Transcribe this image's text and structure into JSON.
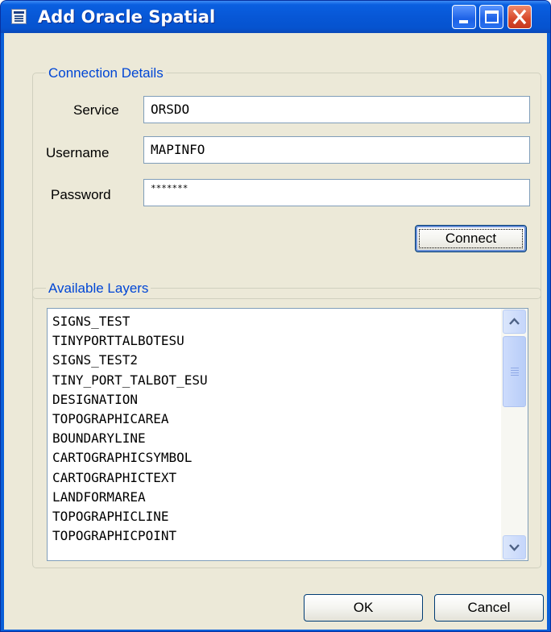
{
  "window": {
    "title": "Add Oracle Spatial"
  },
  "connection": {
    "group_label": "Connection Details",
    "service_label": "Service",
    "service_value": "ORSDO",
    "username_label": "Username",
    "username_value": "MAPINFO",
    "password_label": "Password",
    "password_value": "*******",
    "connect_label": "Connect"
  },
  "layers": {
    "group_label": "Available Layers",
    "items": [
      "SIGNS_TEST",
      "TINYPORTTALBOTESU",
      "SIGNS_TEST2",
      "TINY_PORT_TALBOT_ESU",
      "DESIGNATION",
      "TOPOGRAPHICAREA",
      "BOUNDARYLINE",
      "CARTOGRAPHICSYMBOL",
      "CARTOGRAPHICTEXT",
      "LANDFORMAREA",
      "TOPOGRAPHICLINE",
      "TOPOGRAPHICPOINT"
    ]
  },
  "footer": {
    "ok_label": "OK",
    "cancel_label": "Cancel"
  },
  "icons": {
    "window_icon": "dialog-list-icon",
    "minimize": "minimize-icon",
    "maximize": "maximize-icon",
    "close": "close-icon",
    "scroll_up": "chevron-up-icon",
    "scroll_down": "chevron-down-icon"
  },
  "colors": {
    "titlebar": "#0757d6",
    "client_bg": "#ece9d8",
    "group_label": "#0046d5",
    "close_button": "#d7482a"
  }
}
